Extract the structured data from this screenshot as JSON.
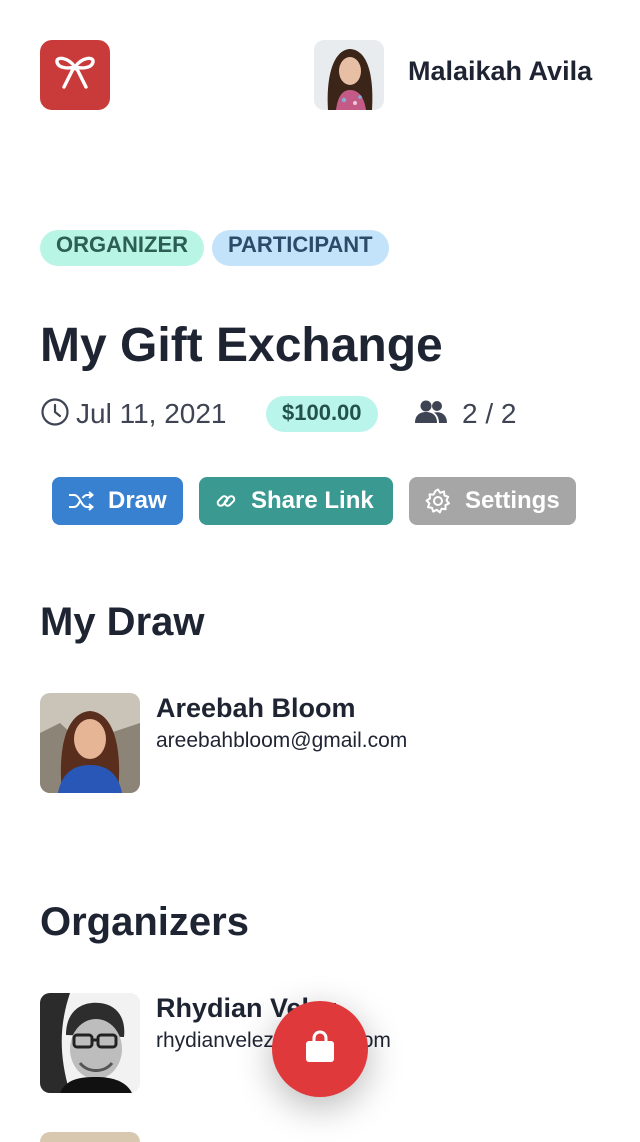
{
  "header": {
    "logo_icon": "gift-bow-icon",
    "user": {
      "name": "Malaikah Avila",
      "avatar": "user-avatar"
    }
  },
  "event": {
    "badges": [
      "ORGANIZER",
      "PARTICIPANT"
    ],
    "title": "My Gift Exchange",
    "date": "Jul 11, 2021",
    "budget": "$100.00",
    "participants": "2 / 2"
  },
  "actions": {
    "draw_label": "Draw",
    "share_label": "Share Link",
    "settings_label": "Settings"
  },
  "my_draw": {
    "title": "My Draw",
    "person": {
      "name": "Areebah Bloom",
      "email": "areebahbloom@gmail.com"
    }
  },
  "organizers": {
    "title": "Organizers",
    "people": [
      {
        "name": "Rhydian Velez",
        "email": "rhydianvelez@gmail.com"
      }
    ]
  },
  "fab": {
    "icon": "shopping-bag-icon"
  },
  "colors": {
    "logo": "#c93b3a",
    "draw_button": "#3880d0",
    "share_button": "#3a9a91",
    "settings_button": "#a6a6a6",
    "fab": "#e0393b",
    "organizer_badge": "#b9f5e4",
    "participant_badge": "#c3e3fb"
  }
}
